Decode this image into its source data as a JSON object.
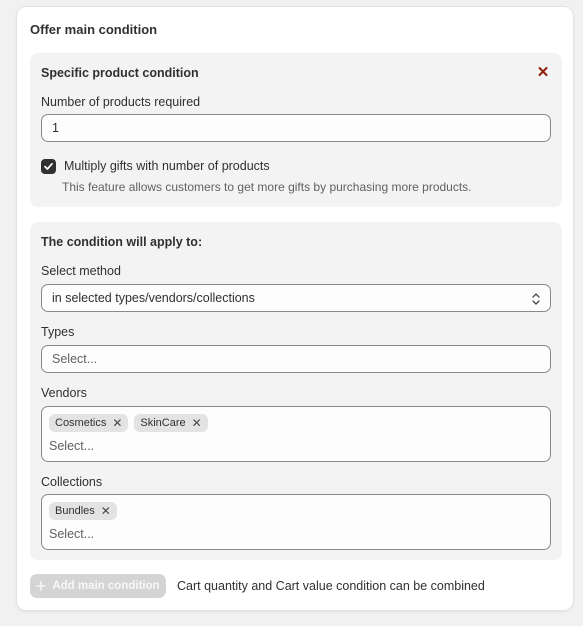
{
  "card": {
    "title": "Offer main condition"
  },
  "specific": {
    "title": "Specific product condition",
    "close_icon": "close-icon",
    "num_label": "Number of products required",
    "num_value": "1",
    "multiply_checked": true,
    "multiply_label": "Multiply gifts with number of products",
    "multiply_help": "This feature allows customers to get more gifts by purchasing more products."
  },
  "apply": {
    "title": "The condition will apply to:",
    "method_label": "Select method",
    "method_value": "in selected types/vendors/collections",
    "types_label": "Types",
    "types_placeholder": "Select...",
    "vendors_label": "Vendors",
    "vendors_tags": [
      "Cosmetics",
      "SkinCare"
    ],
    "vendors_placeholder": "Select...",
    "collections_label": "Collections",
    "collections_tags": [
      "Bundles"
    ],
    "collections_placeholder": "Select..."
  },
  "footer": {
    "add_label": "Add main condition",
    "note": "Cart quantity and Cart value condition can be combined"
  },
  "colors": {
    "accent_dark": "#303030",
    "close_red": "#8e1f0b",
    "disabled_btn": "#d4d4d4"
  }
}
